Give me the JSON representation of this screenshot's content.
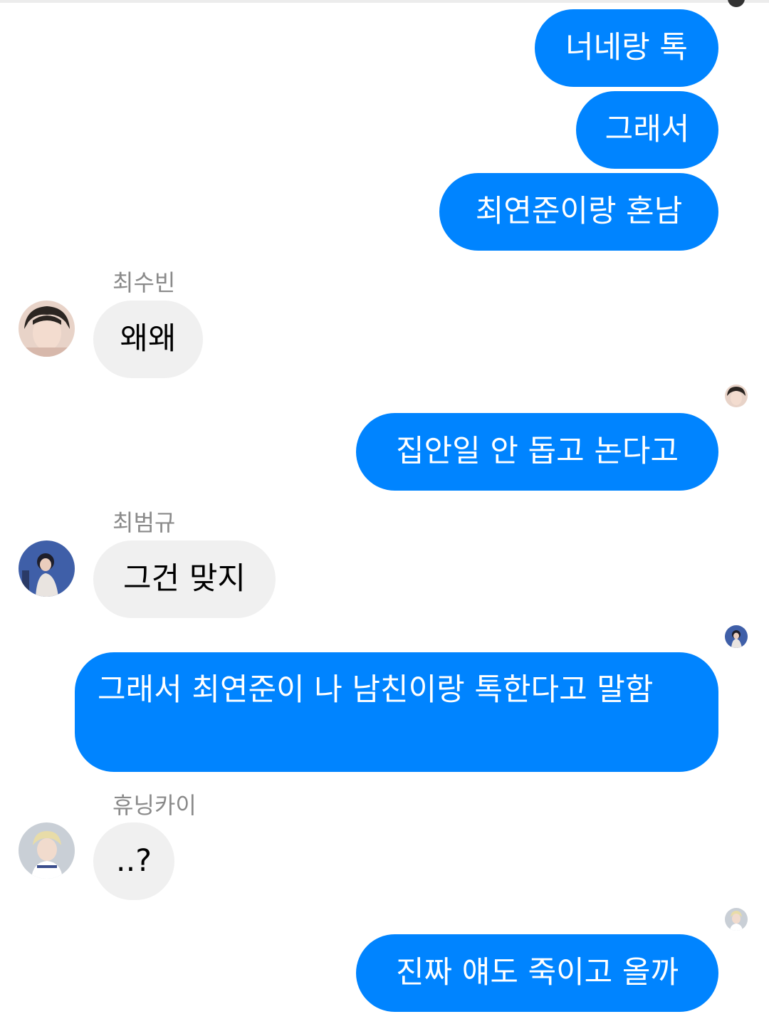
{
  "messages": [
    {
      "text": "너네랑 톡",
      "outgoing": true
    },
    {
      "text": "그래서",
      "outgoing": true
    },
    {
      "text": "최연준이랑 혼남",
      "outgoing": true
    },
    {
      "sender": "최수빈",
      "text": "왜왜",
      "outgoing": false,
      "avatar": "soobin-avatar"
    },
    {
      "text": "집안일 안 돕고 논다고",
      "outgoing": true,
      "read_receipt": "soobin-avatar"
    },
    {
      "sender": "최범규",
      "text": "그건 맞지",
      "outgoing": false,
      "avatar": "beomgyu-avatar"
    },
    {
      "text": "그래서 최연준이 나 남친이랑 톡한다고 말함",
      "outgoing": true,
      "read_receipt": "beomgyu-avatar"
    },
    {
      "sender": "휴닝카이",
      "text": "..?",
      "outgoing": false,
      "avatar": "hueningkai-avatar"
    },
    {
      "text": "진짜 얘도 죽이고 올까",
      "outgoing": true,
      "read_receipt": "hueningkai-avatar"
    }
  ],
  "colors": {
    "outgoing_bubble": "#0084ff",
    "incoming_bubble": "#f0f0f0",
    "sender_name": "#8a8a8a"
  }
}
